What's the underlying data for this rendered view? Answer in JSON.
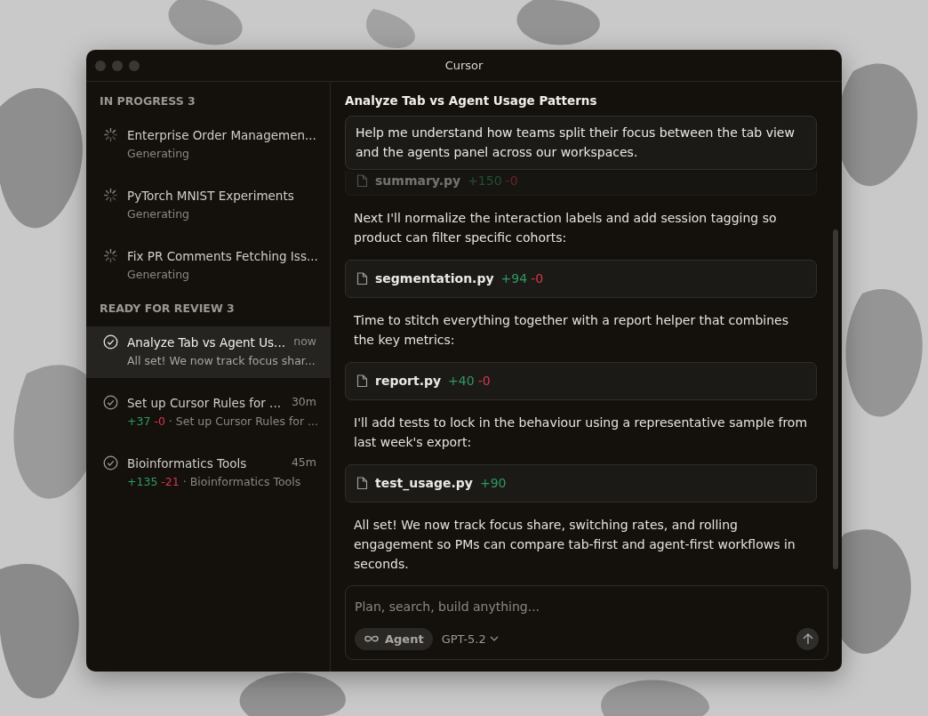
{
  "window": {
    "title": "Cursor"
  },
  "sidebar": {
    "groups": [
      {
        "title": "IN PROGRESS 3",
        "items": [
          {
            "kind": "progress",
            "title": "Enterprise Order Managemen...",
            "subtitle": "Generating",
            "selected": false
          },
          {
            "kind": "progress",
            "title": "PyTorch MNIST Experiments",
            "subtitle": "Generating",
            "selected": false
          },
          {
            "kind": "progress",
            "title": "Fix PR Comments Fetching Iss...",
            "subtitle": "Generating",
            "selected": false
          }
        ]
      },
      {
        "title": "READY FOR REVIEW 3",
        "items": [
          {
            "kind": "done",
            "title": "Analyze Tab vs Agent Us...",
            "time": "now",
            "subtitle": "All set! We now track focus shar...",
            "selected": true
          },
          {
            "kind": "done",
            "title": "Set up Cursor Rules for ...",
            "time": "30m",
            "added": "+37",
            "removed": "-0",
            "separator": "·",
            "subtitle": "Set up Cursor Rules for ...",
            "selected": false
          },
          {
            "kind": "done",
            "title": "Bioinformatics Tools",
            "time": "45m",
            "added": "+135",
            "removed": "-21",
            "separator": "·",
            "subtitle": "Bioinformatics Tools",
            "selected": false
          }
        ]
      }
    ]
  },
  "chat": {
    "title": "Analyze Tab vs Agent Usage Patterns",
    "prompt": "Help me understand how teams split their focus between the tab view and the agents panel across our workspaces.",
    "messages": [
      {
        "kind": "file",
        "name": "summary.py",
        "added": "+150",
        "removed": "-0"
      },
      {
        "kind": "text",
        "text": "Next I'll normalize the interaction labels and add session tagging so product can filter specific cohorts:"
      },
      {
        "kind": "file",
        "name": "segmentation.py",
        "added": "+94",
        "removed": "-0"
      },
      {
        "kind": "text",
        "text": "Time to stitch everything together with a report helper that combines the key metrics:"
      },
      {
        "kind": "file",
        "name": "report.py",
        "added": "+40",
        "removed": "-0"
      },
      {
        "kind": "text",
        "text": "I'll add tests to lock in the behaviour using a representative sample from last week's export:"
      },
      {
        "kind": "file",
        "name": "test_usage.py",
        "added": "+90"
      },
      {
        "kind": "text",
        "text": "All set! We now track focus share, switching rates, and rolling engagement so PMs can compare tab-first and agent-first workflows in seconds."
      }
    ]
  },
  "composer": {
    "placeholder": "Plan, search, build anything...",
    "mode": "Agent",
    "model": "GPT-5.2"
  }
}
